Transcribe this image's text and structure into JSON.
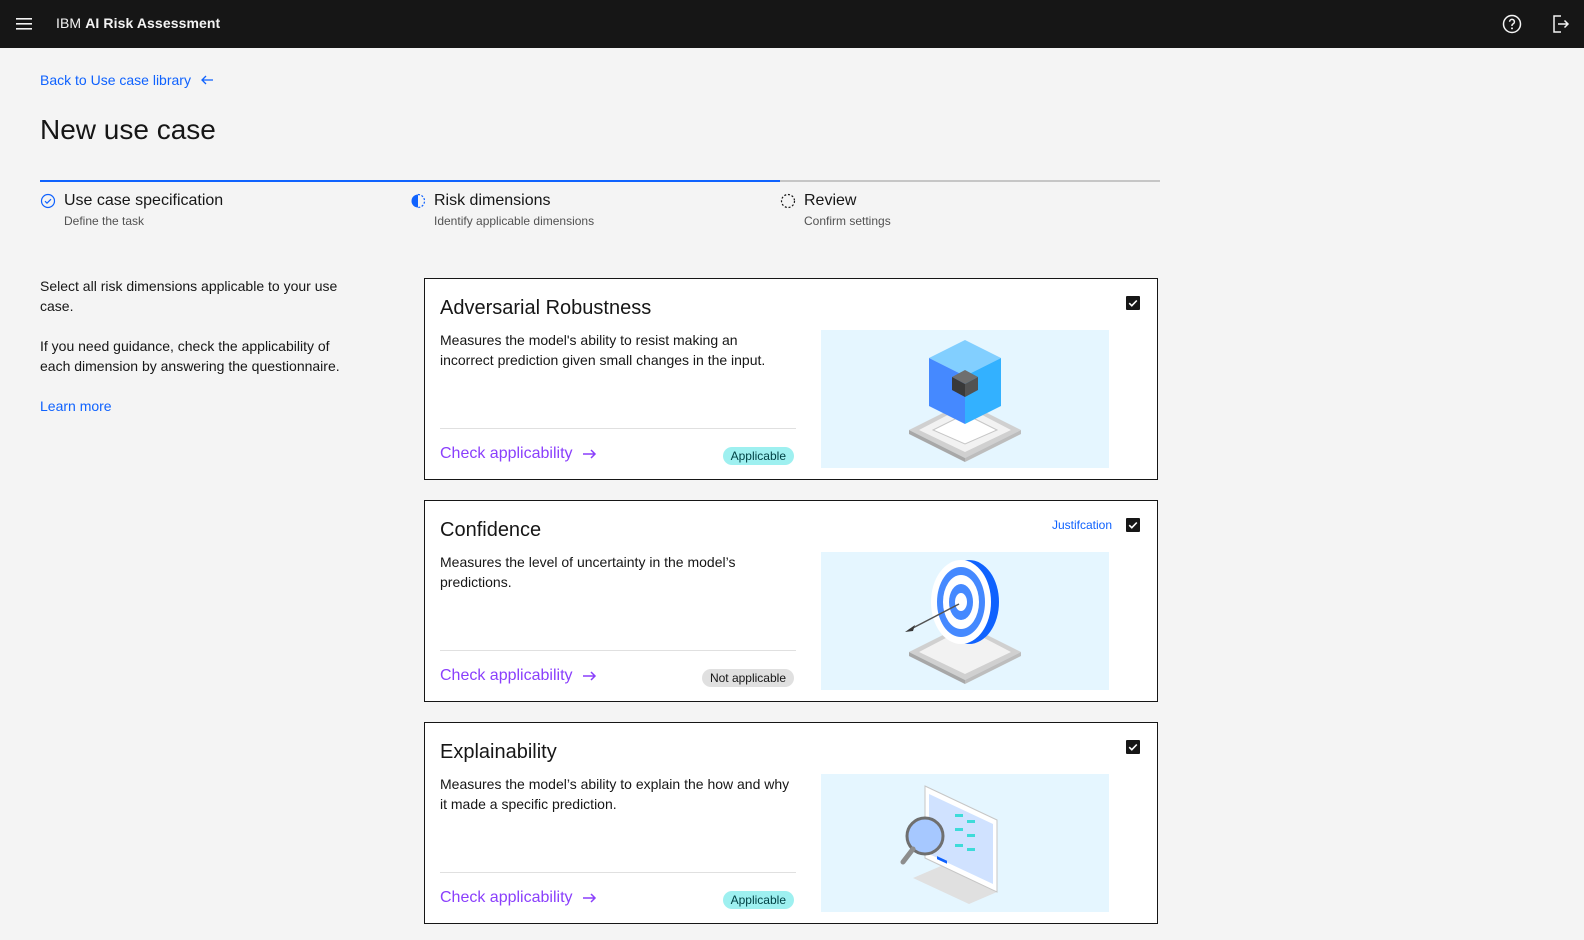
{
  "header": {
    "brand": "IBM",
    "product": "AI Risk Assessment",
    "menu_icon": "hamburger-menu-icon",
    "help_icon": "help-icon",
    "logout_icon": "logout-icon"
  },
  "back_link": "Back to Use case library",
  "page_title": "New use case",
  "steps": [
    {
      "label": "Use case specification",
      "sublabel": "Define the task",
      "status": "complete"
    },
    {
      "label": "Risk dimensions",
      "sublabel": "Identify applicable dimensions",
      "status": "current"
    },
    {
      "label": "Review",
      "sublabel": "Confirm settings",
      "status": "incomplete"
    }
  ],
  "intro": {
    "p1": "Select all risk dimensions applicable to your use case.",
    "p2": "If you need guidance, check the applicability of each dimension by answering the questionnaire.",
    "learn_more": "Learn more"
  },
  "cards": [
    {
      "title": "Adversarial Robustness",
      "description": "Measures the model's ability to resist making an incorrect prediction given small changes in the input.",
      "check_label": "Check applicability",
      "tag": "Applicable",
      "checked": true,
      "justification": ""
    },
    {
      "title": "Confidence",
      "description": "Measures the level of uncertainty in the model’s predictions.",
      "check_label": "Check applicability",
      "tag": "Not applicable",
      "checked": true,
      "justification": "Justifcation"
    },
    {
      "title": "Explainability",
      "description": "Measures the model’s ability to explain the how and why it made a specific prediction.",
      "check_label": "Check applicability",
      "tag": "Applicable",
      "checked": true,
      "justification": ""
    }
  ],
  "colors": {
    "accent": "#0f62fe",
    "purple_link": "#8a3ffc",
    "tag_applicable": "#9ef0f0",
    "tag_not_applicable": "#e0e0e0",
    "header_bg": "#161616",
    "illustration_bg": "#e5f6ff"
  }
}
